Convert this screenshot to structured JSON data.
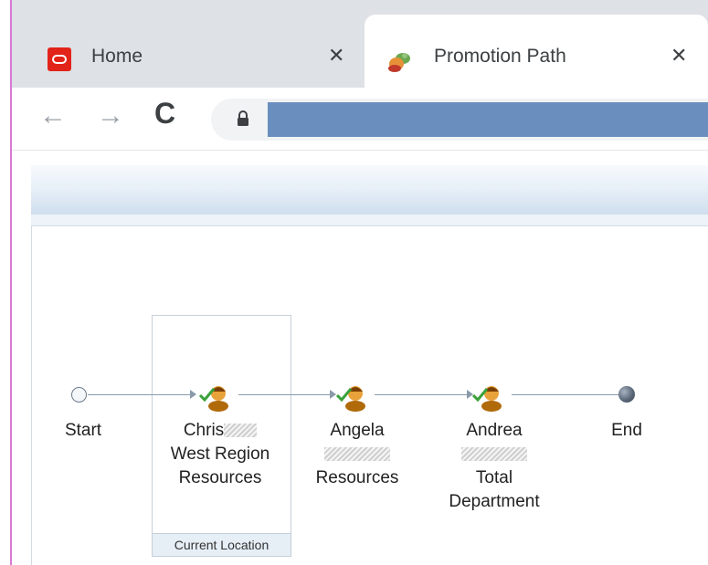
{
  "browser": {
    "tabs": [
      {
        "label": "Home",
        "icon": "oracle-logo-icon",
        "active": false
      },
      {
        "label": "Promotion Path",
        "icon": "promotion-path-icon",
        "active": true
      }
    ],
    "close_glyph": "✕",
    "toolbar": {
      "back": "←",
      "forward": "→",
      "reload": "C"
    }
  },
  "workflow": {
    "current_location_label": "Current Location",
    "nodes": [
      {
        "id": "start",
        "lines": [
          "Start"
        ]
      },
      {
        "id": "chris",
        "lines": [
          "Chris",
          "West Region",
          "Resources"
        ],
        "redacted_suffix_line": 0
      },
      {
        "id": "angela",
        "lines": [
          "Angela",
          "",
          "Resources"
        ],
        "redacted_line": 1
      },
      {
        "id": "andrea",
        "lines": [
          "Andrea",
          "",
          "Total",
          "Department"
        ],
        "redacted_line": 1
      },
      {
        "id": "end",
        "lines": [
          "End"
        ]
      }
    ]
  },
  "colors": {
    "url_bar": "#6a8fbf",
    "oracle_red": "#e2231a",
    "current_location_bg": "#e6eef6",
    "left_edge": "#d77ad3"
  }
}
